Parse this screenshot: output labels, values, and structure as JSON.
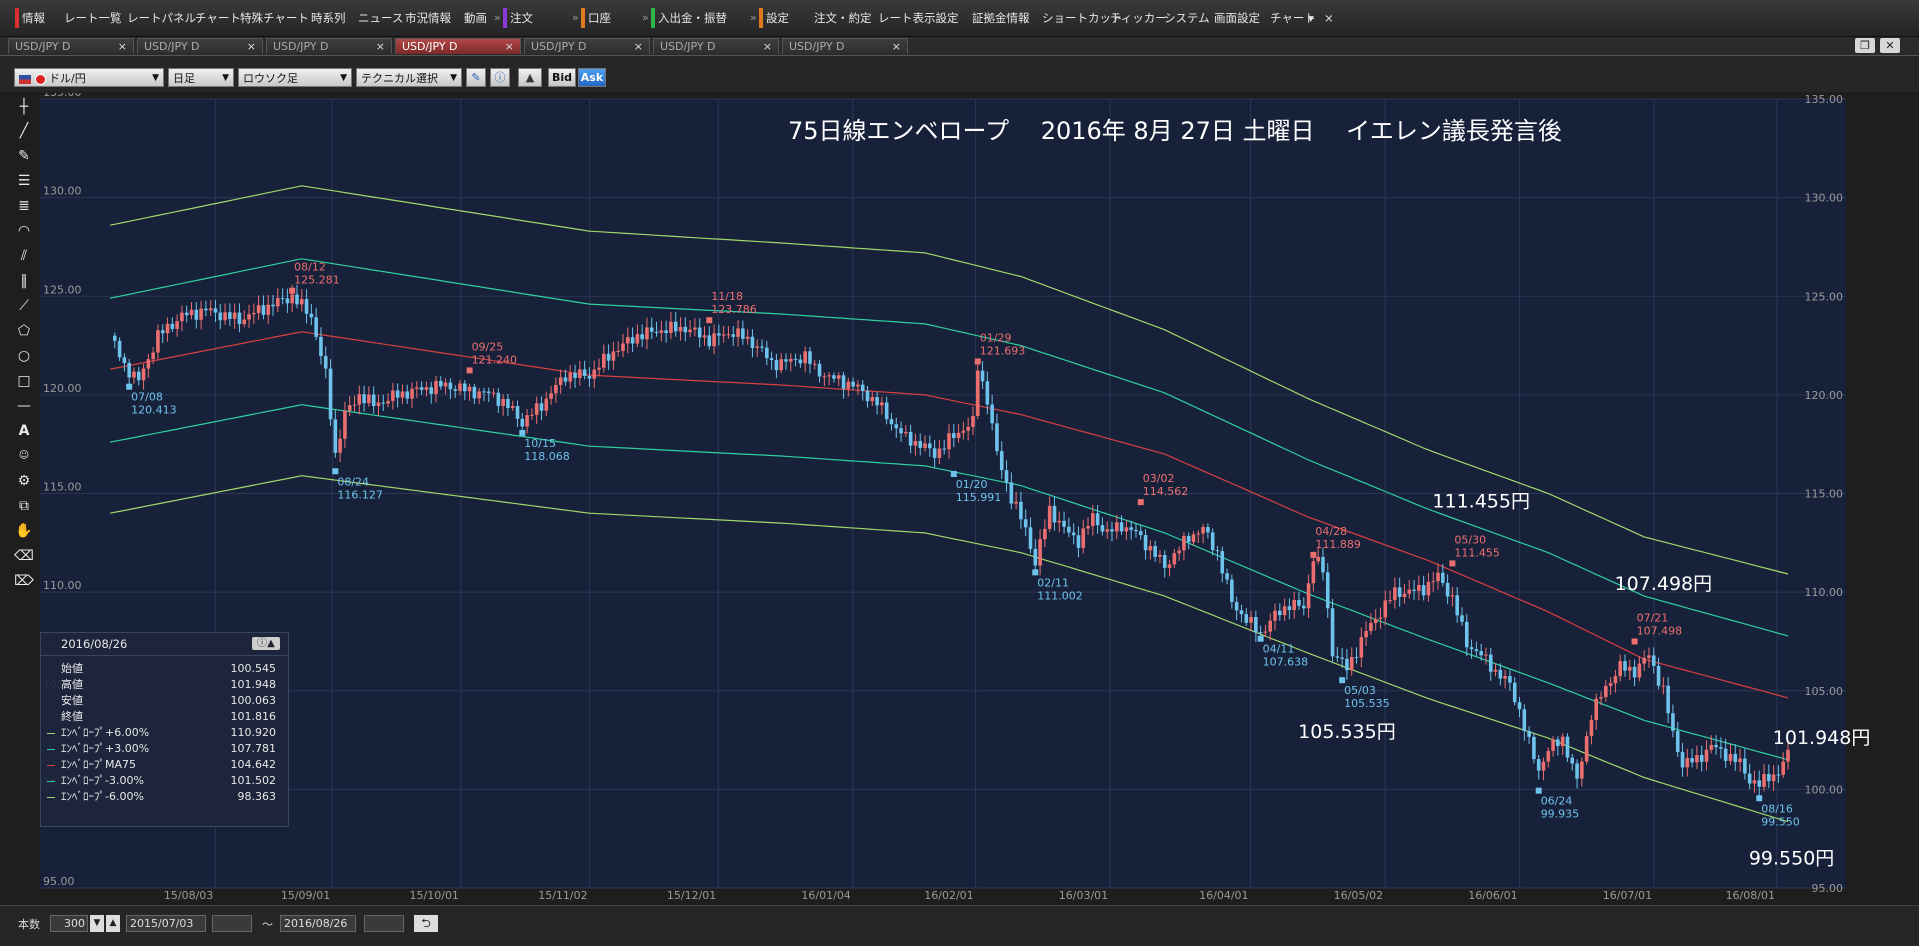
{
  "menu": {
    "items": [
      "情報",
      "レート一覧",
      "レートパネル",
      "チャート",
      "特殊チャート",
      "時系列",
      "ニュース",
      "市況情報",
      "動画",
      "注文",
      "口座",
      "入出金・振替",
      "設定",
      "注文・約定",
      "レート表示設定",
      "証拠金情報",
      "ショートカット",
      "ティッカー",
      "システム",
      "画面設定",
      "チャート"
    ],
    "more": "▾",
    "close": "×"
  },
  "tabs": [
    {
      "label": "USD/JPY D",
      "active": false
    },
    {
      "label": "USD/JPY D",
      "active": false
    },
    {
      "label": "USD/JPY D",
      "active": false
    },
    {
      "label": "USD/JPY D",
      "active": true
    },
    {
      "label": "USD/JPY D",
      "active": false
    },
    {
      "label": "USD/JPY D",
      "active": false
    },
    {
      "label": "USD/JPY D",
      "active": false
    }
  ],
  "tab_close": "×",
  "toolbar": {
    "symbol": "ドル/円",
    "period": "日足",
    "chart_type": "ロウソク足",
    "technical": "テクニカル選択",
    "bid": "Bid",
    "ask": "Ask"
  },
  "info_panel": {
    "date": "2016/08/26",
    "rows": [
      {
        "label": "始値",
        "value": "100.545",
        "color": ""
      },
      {
        "label": "高値",
        "value": "101.948",
        "color": ""
      },
      {
        "label": "安値",
        "value": "100.063",
        "color": ""
      },
      {
        "label": "終値",
        "value": "101.816",
        "color": ""
      },
      {
        "label": "ｴﾝﾍﾞﾛｰﾌﾟ+6.00%",
        "value": "110.920",
        "color": "#9fd86a"
      },
      {
        "label": "ｴﾝﾍﾞﾛｰﾌﾟ+3.00%",
        "value": "107.781",
        "color": "#2fd0a0"
      },
      {
        "label": "ｴﾝﾍﾞﾛｰﾌﾟMA75",
        "value": "104.642",
        "color": "#d84040"
      },
      {
        "label": "ｴﾝﾍﾞﾛｰﾌﾟ-3.00%",
        "value": "101.502",
        "color": "#2fd0a0"
      },
      {
        "label": "ｴﾝﾍﾞﾛｰﾌﾟ-6.00%",
        "value": "98.363",
        "color": "#9fd86a"
      }
    ]
  },
  "bottom": {
    "count_label": "本数",
    "count_value": "300",
    "from_date": "2015/07/03",
    "tilde": "〜",
    "to_date": "2016/08/26",
    "refresh": "⮌"
  },
  "chart_data": {
    "type": "candlestick",
    "title": "75日線エンベロープ　 2016年 8月 27日 土曜日　 イエレン議長発言後",
    "ylim": [
      95,
      135
    ],
    "yticks": [
      "135.00",
      "130.00",
      "125.00",
      "120.00",
      "115.00",
      "110.00",
      "105.00",
      "100.00",
      "95.00"
    ],
    "xticks": [
      "15/08/03",
      "15/09/01",
      "15/10/01",
      "15/11/02",
      "15/12/01",
      "16/01/04",
      "16/02/01",
      "16/03/01",
      "16/04/01",
      "16/05/02",
      "16/06/01",
      "16/07/01",
      "16/08/01"
    ],
    "close_path": [
      [
        0,
        123.0
      ],
      [
        3,
        121.5
      ],
      [
        6,
        120.7
      ],
      [
        10,
        123.0
      ],
      [
        15,
        124.0
      ],
      [
        20,
        124.3
      ],
      [
        27,
        123.8
      ],
      [
        33,
        124.5
      ],
      [
        38,
        125.0
      ],
      [
        42,
        124.0
      ],
      [
        45,
        121.0
      ],
      [
        47,
        117.0
      ],
      [
        49,
        119.0
      ],
      [
        52,
        120.0
      ],
      [
        55,
        119.5
      ],
      [
        60,
        120.0
      ],
      [
        65,
        120.3
      ],
      [
        70,
        120.5
      ],
      [
        75,
        120.2
      ],
      [
        80,
        120.0
      ],
      [
        84,
        119.2
      ],
      [
        86,
        118.6
      ],
      [
        90,
        119.5
      ],
      [
        95,
        121.0
      ],
      [
        100,
        121.0
      ],
      [
        105,
        122.2
      ],
      [
        110,
        123.0
      ],
      [
        115,
        123.3
      ],
      [
        120,
        123.4
      ],
      [
        125,
        122.8
      ],
      [
        130,
        123.2
      ],
      [
        135,
        122.5
      ],
      [
        138,
        121.6
      ],
      [
        142,
        121.7
      ],
      [
        145,
        122.0
      ],
      [
        147,
        121.3
      ],
      [
        150,
        120.9
      ],
      [
        155,
        120.5
      ],
      [
        160,
        119.6
      ],
      [
        163,
        118.6
      ],
      [
        166,
        117.8
      ],
      [
        169,
        117.5
      ],
      [
        172,
        117.0
      ],
      [
        175,
        117.7
      ],
      [
        178,
        118.3
      ],
      [
        180,
        118.6
      ],
      [
        181,
        121.4
      ],
      [
        183,
        119.8
      ],
      [
        185,
        117.0
      ],
      [
        188,
        114.8
      ],
      [
        191,
        113.2
      ],
      [
        193,
        111.5
      ],
      [
        196,
        114.2
      ],
      [
        199,
        113.2
      ],
      [
        202,
        112.6
      ],
      [
        205,
        113.8
      ],
      [
        208,
        113.0
      ],
      [
        211,
        113.4
      ],
      [
        214,
        113.0
      ],
      [
        217,
        112.2
      ],
      [
        220,
        111.3
      ],
      [
        225,
        112.8
      ],
      [
        228,
        113.2
      ],
      [
        231,
        112.0
      ],
      [
        234,
        109.5
      ],
      [
        237,
        108.6
      ],
      [
        240,
        107.9
      ],
      [
        243,
        108.8
      ],
      [
        246,
        109.4
      ],
      [
        249,
        109.2
      ],
      [
        251,
        111.8
      ],
      [
        253,
        111.1
      ],
      [
        255,
        107.0
      ],
      [
        258,
        106.1
      ],
      [
        262,
        108.0
      ],
      [
        265,
        109.0
      ],
      [
        268,
        110.0
      ],
      [
        271,
        110.0
      ],
      [
        274,
        110.2
      ],
      [
        277,
        110.8
      ],
      [
        280,
        109.7
      ],
      [
        283,
        107.4
      ],
      [
        286,
        106.8
      ],
      [
        289,
        106.0
      ],
      [
        292,
        105.3
      ],
      [
        294,
        104.0
      ],
      [
        296,
        102.3
      ],
      [
        298,
        101.0
      ],
      [
        300,
        102.0
      ],
      [
        303,
        102.6
      ],
      [
        306,
        100.4
      ],
      [
        309,
        103.8
      ],
      [
        312,
        105.2
      ],
      [
        315,
        106.2
      ],
      [
        318,
        106.0
      ],
      [
        321,
        106.8
      ],
      [
        324,
        105.0
      ],
      [
        326,
        102.8
      ],
      [
        328,
        101.3
      ],
      [
        331,
        101.5
      ],
      [
        334,
        102.2
      ],
      [
        337,
        101.8
      ],
      [
        340,
        101.3
      ],
      [
        342,
        100.5
      ],
      [
        344,
        100.2
      ],
      [
        346,
        100.7
      ],
      [
        348,
        100.8
      ],
      [
        350,
        101.8
      ]
    ],
    "ma75": [
      [
        0,
        121.3
      ],
      [
        40,
        123.2
      ],
      [
        100,
        121.0
      ],
      [
        140,
        120.5
      ],
      [
        170,
        120.0
      ],
      [
        190,
        119.0
      ],
      [
        220,
        117.0
      ],
      [
        250,
        113.8
      ],
      [
        275,
        111.6
      ],
      [
        300,
        109.0
      ],
      [
        320,
        106.6
      ],
      [
        350,
        104.64
      ]
    ],
    "env_plus6": [
      [
        0,
        128.6
      ],
      [
        40,
        130.6
      ],
      [
        100,
        128.3
      ],
      [
        140,
        127.7
      ],
      [
        170,
        127.2
      ],
      [
        190,
        126.0
      ],
      [
        220,
        123.3
      ],
      [
        250,
        119.8
      ],
      [
        275,
        117.2
      ],
      [
        300,
        115.0
      ],
      [
        320,
        112.8
      ],
      [
        350,
        110.92
      ]
    ],
    "env_plus3": [
      [
        0,
        124.9
      ],
      [
        40,
        126.9
      ],
      [
        100,
        124.6
      ],
      [
        140,
        124.1
      ],
      [
        170,
        123.6
      ],
      [
        190,
        122.5
      ],
      [
        220,
        120.1
      ],
      [
        250,
        116.7
      ],
      [
        275,
        114.2
      ],
      [
        300,
        112.0
      ],
      [
        320,
        109.8
      ],
      [
        350,
        107.78
      ]
    ],
    "env_minus3": [
      [
        0,
        117.6
      ],
      [
        40,
        119.5
      ],
      [
        100,
        117.4
      ],
      [
        140,
        116.9
      ],
      [
        170,
        116.4
      ],
      [
        190,
        115.4
      ],
      [
        220,
        113.0
      ],
      [
        250,
        109.9
      ],
      [
        275,
        107.6
      ],
      [
        300,
        105.4
      ],
      [
        320,
        103.5
      ],
      [
        350,
        101.5
      ]
    ],
    "env_minus6": [
      [
        0,
        114.0
      ],
      [
        40,
        115.9
      ],
      [
        100,
        114.0
      ],
      [
        140,
        113.5
      ],
      [
        170,
        113.0
      ],
      [
        190,
        112.0
      ],
      [
        220,
        109.8
      ],
      [
        250,
        106.9
      ],
      [
        275,
        104.6
      ],
      [
        300,
        102.6
      ],
      [
        320,
        100.6
      ],
      [
        350,
        98.36
      ]
    ],
    "annotations": [
      {
        "i": 38,
        "date": "08/12",
        "price": "125.281",
        "kind": "high"
      },
      {
        "i": 4,
        "date": "07/08",
        "price": "120.413",
        "kind": "low"
      },
      {
        "i": 47,
        "date": "08/24",
        "price": "116.127",
        "kind": "low"
      },
      {
        "i": 75,
        "date": "09/25",
        "price": "121.240",
        "kind": "high"
      },
      {
        "i": 86,
        "date": "10/15",
        "price": "118.068",
        "kind": "low"
      },
      {
        "i": 125,
        "date": "11/18",
        "price": "123.786",
        "kind": "high"
      },
      {
        "i": 181,
        "date": "01/29",
        "price": "121.693",
        "kind": "high"
      },
      {
        "i": 176,
        "date": "01/20",
        "price": "115.991",
        "kind": "low"
      },
      {
        "i": 193,
        "date": "02/11",
        "price": "111.002",
        "kind": "low"
      },
      {
        "i": 215,
        "date": "03/02",
        "price": "114.562",
        "kind": "high"
      },
      {
        "i": 240,
        "date": "04/11",
        "price": "107.638",
        "kind": "low"
      },
      {
        "i": 251,
        "date": "04/28",
        "price": "111.889",
        "kind": "high"
      },
      {
        "i": 257,
        "date": "05/03",
        "price": "105.535",
        "kind": "low"
      },
      {
        "i": 280,
        "date": "05/30",
        "price": "111.455",
        "kind": "high"
      },
      {
        "i": 298,
        "date": "06/24",
        "price": "99.935",
        "kind": "low"
      },
      {
        "i": 318,
        "date": "07/21",
        "price": "107.498",
        "kind": "high"
      },
      {
        "i": 344,
        "date": "08/16",
        "price": "99.550",
        "kind": "low"
      }
    ],
    "big_labels": [
      {
        "text": "111.455円",
        "i": 280,
        "price": 114.3
      },
      {
        "text": "105.535円",
        "i": 252,
        "price": 102.6
      },
      {
        "text": "107.498円",
        "i": 318,
        "price": 110.1
      },
      {
        "text": "101.948円",
        "i": 351,
        "price": 102.3
      },
      {
        "text": "99.550円",
        "i": 346,
        "price": 96.2
      }
    ],
    "colors": {
      "background": "#18213a",
      "grid": "#2c3656",
      "up": "#ec6f70",
      "down": "#6ec3ec",
      "ma": "#d84040",
      "env3": "#2fd0a0",
      "env6": "#9fd86a",
      "axis_text": "#9a9a9a",
      "high_label": "#ec6f70",
      "low_label": "#6ec3ec"
    }
  }
}
